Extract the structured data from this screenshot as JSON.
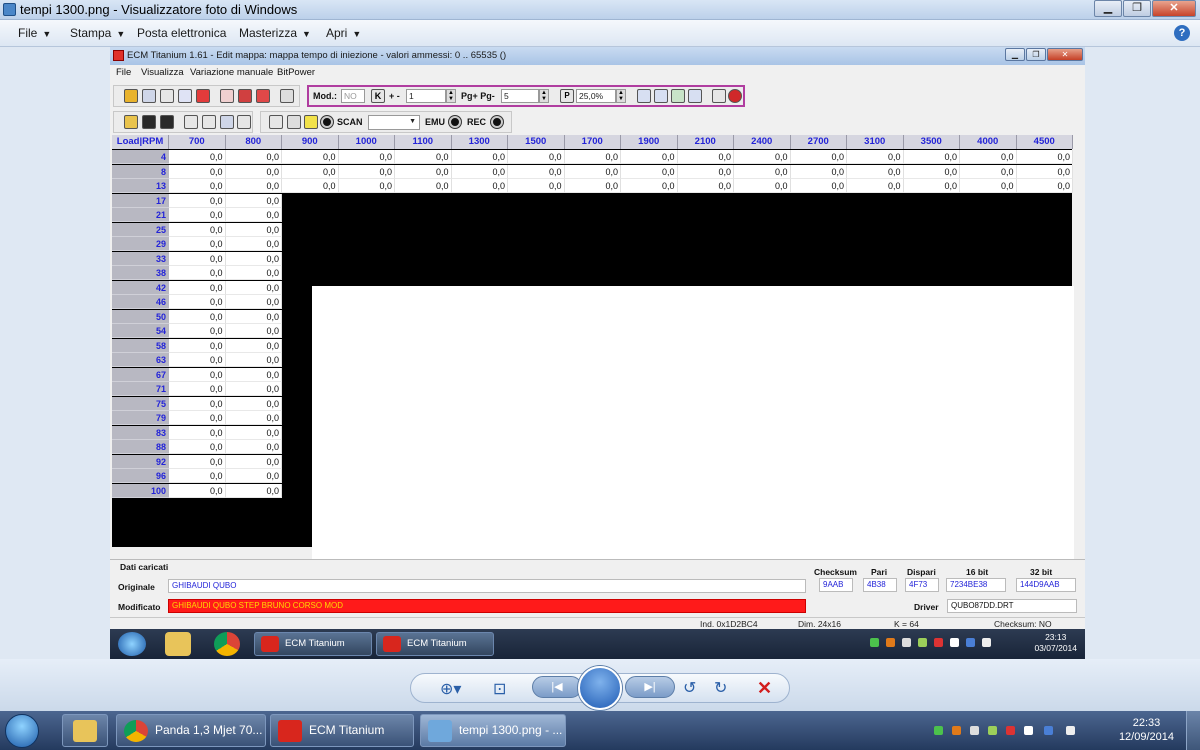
{
  "outer": {
    "title": "tempi 1300.png - Visualizzatore foto di Windows",
    "menu": [
      "File",
      "Stampa",
      "Posta elettronica",
      "Masterizza",
      "Apri"
    ],
    "help": "?"
  },
  "inner": {
    "title": "ECM Titanium 1.61 - Edit mappa: mappa tempo di iniezione - valori ammessi: 0 .. 65535 ()",
    "menu": [
      "File",
      "Visualizza",
      "Variazione manuale",
      "BitPower"
    ],
    "toolbar": {
      "mod_label": "Mod.:",
      "mod_value": "NO",
      "k_label": "K",
      "plusminus_label": "+ -",
      "plusminus_value": "1",
      "pg_label": "Pg+ Pg-",
      "pg_value": "5",
      "p_label": "P",
      "percent_value": "25,0%",
      "scan_label": "SCAN",
      "emu_label": "EMU",
      "rec_label": "REC"
    },
    "grid": {
      "corner": "Load|RPM",
      "rpm": [
        "700",
        "800",
        "900",
        "1000",
        "1100",
        "1300",
        "1500",
        "1700",
        "1900",
        "2100",
        "2400",
        "2700",
        "3100",
        "3500",
        "4000",
        "4500"
      ],
      "loads": [
        "4",
        "8",
        "13",
        "17",
        "21",
        "25",
        "29",
        "33",
        "38",
        "42",
        "46",
        "50",
        "54",
        "58",
        "63",
        "67",
        "71",
        "75",
        "79",
        "83",
        "88",
        "92",
        "96",
        "100"
      ],
      "cell_value": "0,0"
    },
    "info": {
      "section_title": "Dati caricati",
      "originale_label": "Originale",
      "originale_value": "GHIBAUDI QUBO",
      "modificato_label": "Modificato",
      "modificato_value": "GHIBAUDI QUBO STEP BRUNO CORSO MOD",
      "checksum_label": "Checksum",
      "checksum_value": "9AAB",
      "pari_label": "Pari",
      "pari_value": "4B38",
      "dispari_label": "Dispari",
      "dispari_value": "4F73",
      "bit16_label": "16 bit",
      "bit16_value": "7234BE38",
      "bit32_label": "32 bit",
      "bit32_value": "144D9AAB",
      "driver_label": "Driver",
      "driver_value": "QUBO87DD.DRT"
    },
    "status": {
      "ind": "Ind. 0x1D2BC4",
      "dim": "Dim. 24x16",
      "k": "K = 64",
      "checksum": "Checksum: NO"
    },
    "taskbar": {
      "apps": [
        "ECM Titanium",
        "ECM Titanium"
      ],
      "time": "23:13",
      "date": "03/07/2014"
    }
  },
  "taskbar": {
    "apps": [
      "Panda 1,3 Mjet 70...",
      "ECM Titanium",
      "tempi 1300.png - ..."
    ],
    "time": "22:33",
    "date": "12/09/2014"
  },
  "colors": {
    "modified_bg": "#ff1a1a",
    "modified_text": "#ffd800",
    "header_text": "#2323d8"
  }
}
